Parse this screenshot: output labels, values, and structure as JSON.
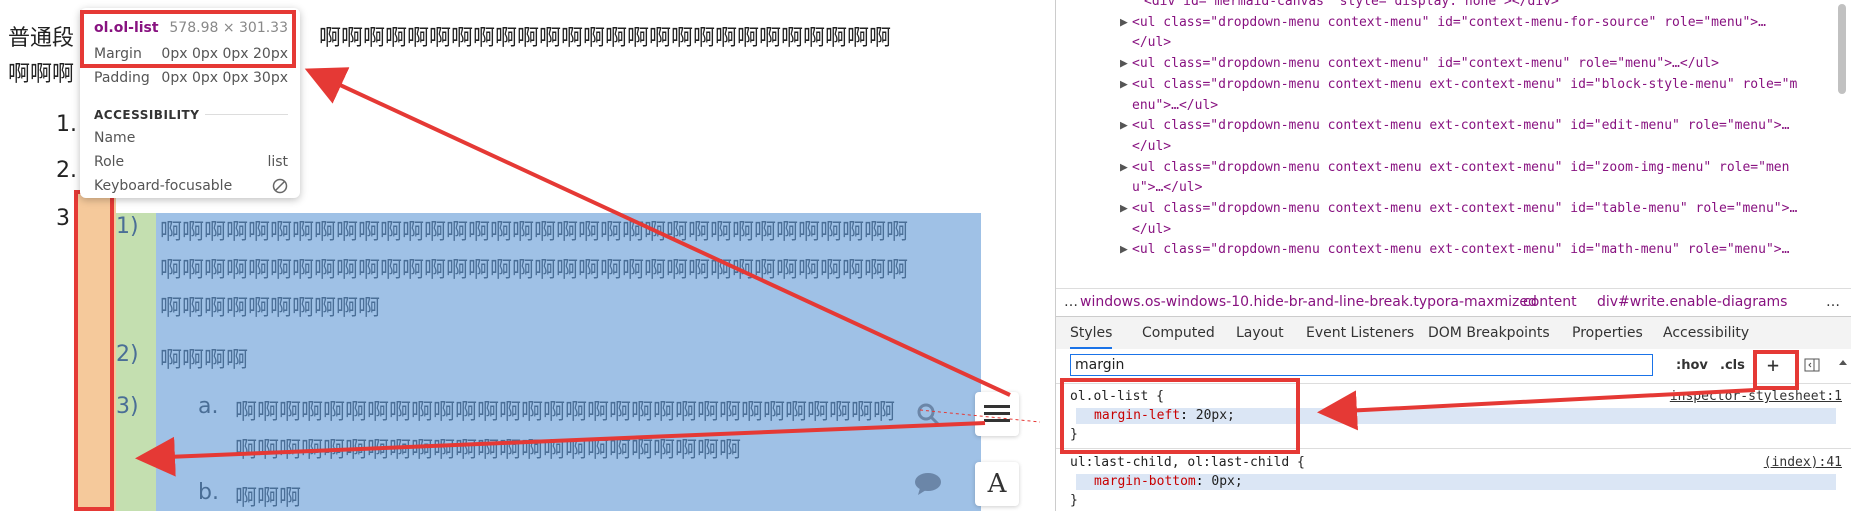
{
  "document": {
    "para_line1_prefix": "普通段",
    "para_line1_rest": "啊啊啊啊啊啊啊啊啊啊啊啊啊啊啊啊啊啊啊啊啊啊啊啊啊啊",
    "para_line2": "啊啊啊",
    "list_numbers": [
      "1.",
      "2.",
      "3"
    ],
    "sub_items": [
      {
        "marker": "1)",
        "lines": [
          "啊啊啊啊啊啊啊啊啊啊啊啊啊啊啊啊啊啊啊啊啊啊啊啊啊啊啊啊啊啊啊啊啊啊",
          "啊啊啊啊啊啊啊啊啊啊啊啊啊啊啊啊啊啊啊啊啊啊啊啊啊啊啊啊啊啊啊啊啊啊",
          "啊啊啊啊啊啊啊啊啊啊"
        ]
      },
      {
        "marker": "2)",
        "lines": [
          "啊啊啊啊"
        ]
      },
      {
        "marker": "3)",
        "lines": []
      }
    ],
    "sub_sub_items": [
      {
        "marker": "a.",
        "lines": [
          "啊啊啊啊啊啊啊啊啊啊啊啊啊啊啊啊啊啊啊啊啊啊啊啊啊啊啊啊啊啊",
          "啊啊啊啊啊啊啊啊啊啊啊啊啊啊啊啊啊啊啊啊啊啊啊"
        ]
      },
      {
        "marker": "b.",
        "lines": [
          "啊啊啊"
        ]
      }
    ]
  },
  "tooltip": {
    "title": "ol.ol-list",
    "size": "578.98 × 301.33",
    "margin_label": "Margin",
    "margin_value": "0px 0px 0px 20px",
    "padding_label": "Padding",
    "padding_value": "0px 0px 0px 30px",
    "accessibility_heading": "ACCESSIBILITY",
    "name_label": "Name",
    "role_label": "Role",
    "role_value": "list",
    "keyboard_label": "Keyboard-focusable"
  },
  "floating_buttons": {
    "outline_icon": "hamburger-icon",
    "search_icon": "search-icon",
    "comment_icon": "comment-icon",
    "font_label": "A"
  },
  "devtools": {
    "dom_lines": [
      {
        "text": "<div id=\"mermaid-canvas\" style=\"display: none\"></div>",
        "tri": ""
      },
      {
        "text": "<ul class=\"dropdown-menu context-menu\" id=\"context-menu-for-source\" role=\"menu\">…",
        "tri": "▶"
      },
      {
        "text": "</ul>",
        "tri": ""
      },
      {
        "text": "<ul class=\"dropdown-menu context-menu\" id=\"context-menu\" role=\"menu\">…</ul>",
        "tri": "▶"
      },
      {
        "text": "<ul class=\"dropdown-menu context-menu ext-context-menu\" id=\"block-style-menu\" role=\"m",
        "tri": "▶"
      },
      {
        "text": "enu\">…</ul>",
        "tri": ""
      },
      {
        "text": "<ul class=\"dropdown-menu context-menu ext-context-menu\" id=\"edit-menu\" role=\"menu\">…",
        "tri": "▶"
      },
      {
        "text": "</ul>",
        "tri": ""
      },
      {
        "text": "<ul class=\"dropdown-menu context-menu ext-context-menu\" id=\"zoom-img-menu\" role=\"men",
        "tri": "▶"
      },
      {
        "text": "u\">…</ul>",
        "tri": ""
      },
      {
        "text": "<ul class=\"dropdown-menu context-menu ext-context-menu\" id=\"table-menu\" role=\"menu\">…",
        "tri": "▶"
      },
      {
        "text": "</ul>",
        "tri": ""
      },
      {
        "text": "<ul class=\"dropdown-menu context-menu ext-context-menu\" id=\"math-menu\" role=\"menu\">…",
        "tri": "▶"
      }
    ],
    "breadcrumbs": [
      "…",
      "windows.os-windows-10.hide-br-and-line-break.typora-maxmized",
      "content",
      "div#write.enable-diagrams",
      "…"
    ],
    "tabs": [
      "Styles",
      "Computed",
      "Layout",
      "Event Listeners",
      "DOM Breakpoints",
      "Properties",
      "Accessibility"
    ],
    "filter_value": "margin",
    "hov_label": ":hov",
    "cls_label": ".cls",
    "plus_label": "+",
    "rules": [
      {
        "selector": "ol.ol-list {",
        "property": "margin-left",
        "value": "20px;",
        "close": "}",
        "source": "inspector-stylesheet:1"
      },
      {
        "selector": "ul:last-child, ol:last-child {",
        "property": "margin-bottom",
        "value": "0px;",
        "close": "}",
        "source": "(index):41"
      }
    ]
  }
}
